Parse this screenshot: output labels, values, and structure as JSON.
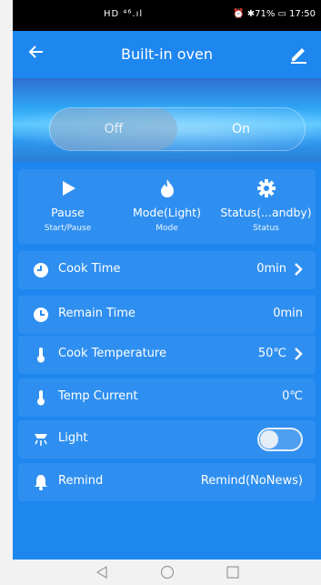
{
  "status_bar": {
    "network": "HD ⁴⁶.ıl ",
    "right": "⏰ ✱71% ▭ 17:50"
  },
  "header": {
    "title": "Built-in oven"
  },
  "power": {
    "off_label": "Off",
    "on_label": "On",
    "selected": "Off"
  },
  "controls": [
    {
      "label": "Pause",
      "sub": "Start/Pause",
      "icon": "play-icon"
    },
    {
      "label": "Mode(Light)",
      "sub": "Mode",
      "icon": "flame-icon"
    },
    {
      "label": "Status(...andby)",
      "sub": "Status",
      "icon": "gear-icon"
    }
  ],
  "rows": [
    {
      "label": "Cook Time",
      "value": "0min",
      "icon": "clock-icon",
      "arrow": true
    },
    {
      "label": "Remain Time",
      "value": "0min",
      "icon": "timer-icon",
      "arrow": false
    },
    {
      "label": "Cook Temperature",
      "value": "50℃",
      "icon": "thermometer-icon",
      "arrow": true
    },
    {
      "label": "Temp Current",
      "value": "0℃",
      "icon": "thermometer-icon",
      "arrow": false
    },
    {
      "label": "Light",
      "value": "",
      "icon": "lamp-icon",
      "toggle": "off"
    },
    {
      "label": "Remind",
      "value": "Remind(NoNews)",
      "icon": "bell-icon",
      "arrow": false
    }
  ],
  "colors": {
    "background": "#1e86ef",
    "accent": "#ffffff"
  }
}
